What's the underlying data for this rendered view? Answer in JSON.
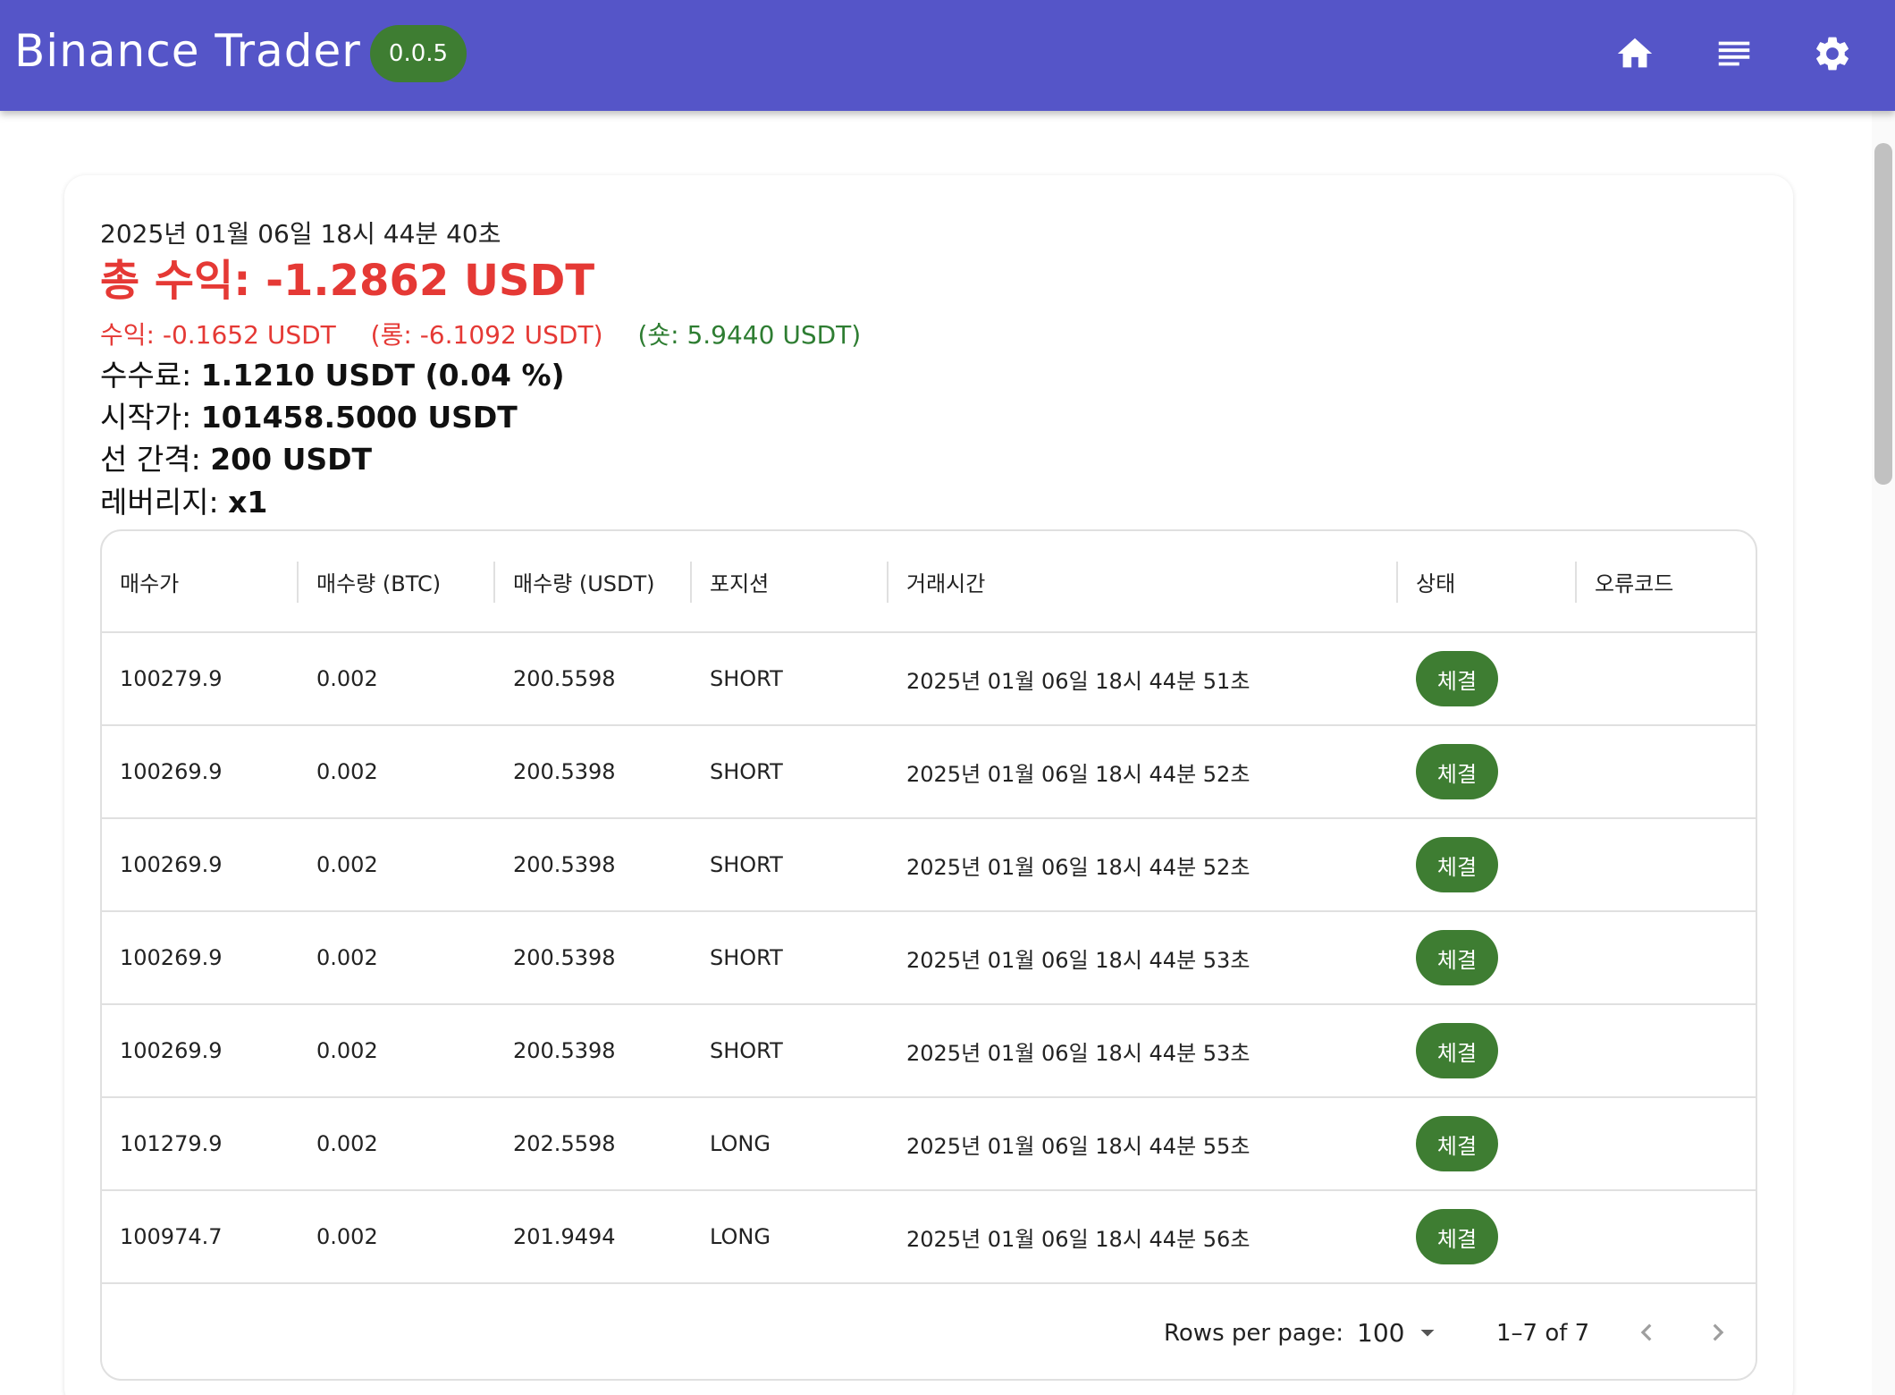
{
  "appbar": {
    "title": "Binance Trader",
    "version": "0.0.5",
    "nav": [
      "home-icon",
      "list-icon",
      "settings-icon"
    ],
    "colors": {
      "bar": "#5555c8",
      "badge": "#3e7d32"
    }
  },
  "summary": {
    "timestamp": "2025년 01월 06일 18시 44분 40초",
    "total_profit": "총 수익: -1.2862 USDT",
    "profit": "수익: -0.1652 USDT",
    "long": "(롱: -6.1092 USDT)",
    "short": "(숏: 5.9440 USDT)",
    "fee_label": "수수료:",
    "fee_value": "1.1210 USDT (0.04 %)",
    "start_label": "시작가:",
    "start_value": "101458.5000 USDT",
    "gap_label": "선 간격:",
    "gap_value": "200 USDT",
    "leverage_label": "레버리지:",
    "leverage_value": "x1"
  },
  "table": {
    "headers": [
      "매수가",
      "매수량 (BTC)",
      "매수량 (USDT)",
      "포지션",
      "거래시간",
      "상태",
      "오류코드"
    ],
    "rows": [
      {
        "price": "100279.9",
        "btc": "0.002",
        "usdt": "200.5598",
        "position": "SHORT",
        "time": "2025년 01월 06일 18시 44분 51초",
        "status": "체결",
        "error": ""
      },
      {
        "price": "100269.9",
        "btc": "0.002",
        "usdt": "200.5398",
        "position": "SHORT",
        "time": "2025년 01월 06일 18시 44분 52초",
        "status": "체결",
        "error": ""
      },
      {
        "price": "100269.9",
        "btc": "0.002",
        "usdt": "200.5398",
        "position": "SHORT",
        "time": "2025년 01월 06일 18시 44분 52초",
        "status": "체결",
        "error": ""
      },
      {
        "price": "100269.9",
        "btc": "0.002",
        "usdt": "200.5398",
        "position": "SHORT",
        "time": "2025년 01월 06일 18시 44분 53초",
        "status": "체결",
        "error": ""
      },
      {
        "price": "100269.9",
        "btc": "0.002",
        "usdt": "200.5398",
        "position": "SHORT",
        "time": "2025년 01월 06일 18시 44분 53초",
        "status": "체결",
        "error": ""
      },
      {
        "price": "101279.9",
        "btc": "0.002",
        "usdt": "202.5598",
        "position": "LONG",
        "time": "2025년 01월 06일 18시 44분 55초",
        "status": "체결",
        "error": ""
      },
      {
        "price": "100974.7",
        "btc": "0.002",
        "usdt": "201.9494",
        "position": "LONG",
        "time": "2025년 01월 06일 18시 44분 56초",
        "status": "체결",
        "error": ""
      }
    ]
  },
  "pagination": {
    "rows_per_page_label": "Rows per page:",
    "rows_per_page": "100",
    "range": "1–7 of 7"
  }
}
